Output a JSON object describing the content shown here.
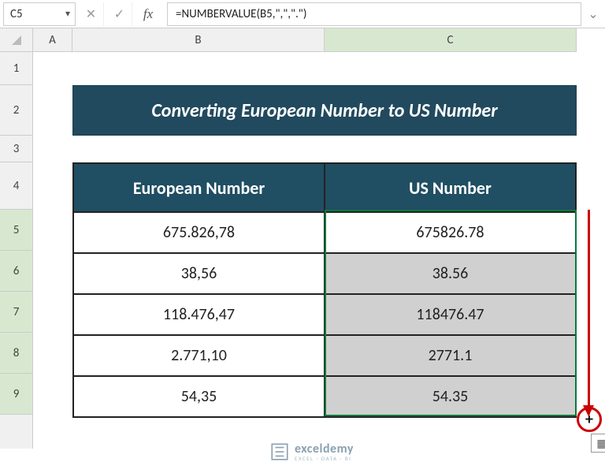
{
  "formula_bar": {
    "cell_ref": "C5",
    "formula": "=NUMBERVALUE(B5,\",\",\".\")"
  },
  "columns": {
    "A": "A",
    "B": "B",
    "C": "C"
  },
  "rows": [
    "1",
    "2",
    "3",
    "4",
    "5",
    "6",
    "7",
    "8",
    "9"
  ],
  "banner": {
    "title": "Converting European Number to US Number"
  },
  "table": {
    "headers": {
      "eu": "European Number",
      "us": "US Number"
    },
    "rows": [
      {
        "eu": "675.826,78",
        "us": "675826.78"
      },
      {
        "eu": "38,56",
        "us": "38.56"
      },
      {
        "eu": "118.476,47",
        "us": "118476.47"
      },
      {
        "eu": "2.771,10",
        "us": "2771.1"
      },
      {
        "eu": "54,35",
        "us": "54.35"
      }
    ]
  },
  "logo": {
    "brand": "exceldemy",
    "tagline": "EXCEL · DATA · BI"
  },
  "fill_cursor": "+",
  "colors": {
    "header_bg": "#204e63",
    "accent": "#0a7a3c",
    "annotation": "#c00"
  }
}
